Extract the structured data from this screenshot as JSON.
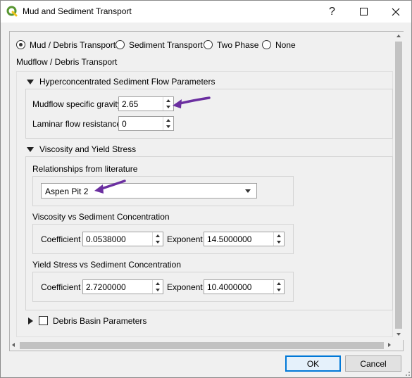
{
  "window": {
    "title": "Mud and Sediment Transport"
  },
  "mode_options": [
    {
      "label": "Mud / Debris Transport",
      "checked": true
    },
    {
      "label": "Sediment Transport",
      "checked": false
    },
    {
      "label": "Two Phase",
      "checked": false
    },
    {
      "label": "None",
      "checked": false
    }
  ],
  "section_title": "Mudflow / Debris Transport",
  "hyper": {
    "header": "Hyperconcentrated Sediment Flow Parameters",
    "gravity_label": "Mudflow specific gravity",
    "gravity_value": "2.65",
    "laminar_label": "Laminar flow resistance",
    "laminar_value": "0"
  },
  "viscosity": {
    "header": "Viscosity and Yield Stress",
    "relationships_label": "Relationships from literature",
    "relationship_selected": "Aspen Pit 2",
    "visc_group_label": "Viscosity vs Sediment Concentration",
    "visc_coef_label": "Coefficient",
    "visc_coef_value": "0.0538000",
    "visc_exp_label": "Exponent",
    "visc_exp_value": "14.5000000",
    "yield_group_label": "Yield Stress vs Sediment Concentration",
    "yield_coef_label": "Coefficient",
    "yield_coef_value": "2.7200000",
    "yield_exp_label": "Exponent",
    "yield_exp_value": "10.4000000"
  },
  "debris": {
    "label": "Debris Basin Parameters"
  },
  "buttons": {
    "ok": "OK",
    "cancel": "Cancel"
  },
  "colors": {
    "annotation_arrow": "#6b2fa0",
    "default_button": "#0078d7",
    "qgis_green": "#589632"
  }
}
